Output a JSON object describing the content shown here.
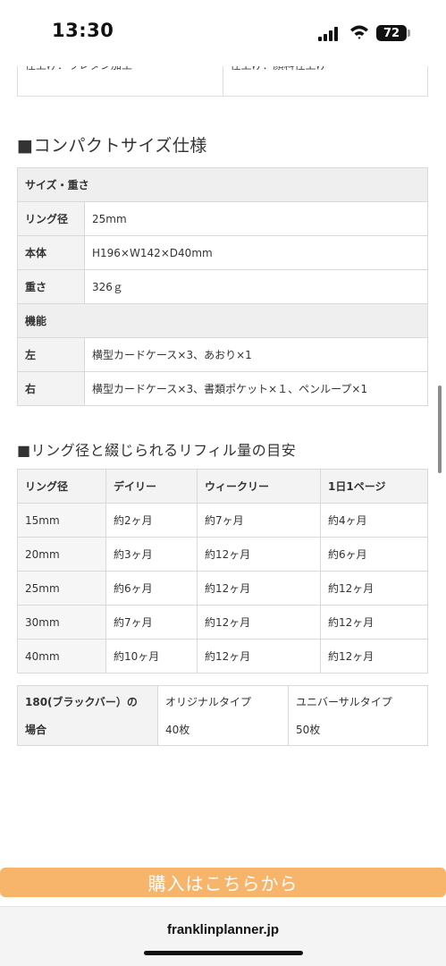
{
  "status_bar": {
    "time": "13:30",
    "battery": "72",
    "icons": [
      "signal-icon",
      "wifi-icon",
      "battery-icon"
    ]
  },
  "top_table": {
    "cells": [
      "仕上げ：ウレタン加工",
      "仕上げ：顔料仕上げ"
    ]
  },
  "compact_section": {
    "title": "■コンパクトサイズ仕様",
    "header": "サイズ・重さ",
    "rows": [
      {
        "label": "リング径",
        "value": "25mm"
      },
      {
        "label": "本体",
        "value": "H196×W142×D40mm"
      },
      {
        "label": "重さ",
        "value": "326ｇ"
      }
    ],
    "function_header": "機能",
    "function_rows": [
      {
        "label": "左",
        "value": "横型カードケース×3、あおり×1"
      },
      {
        "label": "右",
        "value": "横型カードケース×3、書類ポケット×１、ペンループ×1"
      }
    ]
  },
  "ring_section": {
    "title": "■リング径と綴じられるリフィル量の目安",
    "headers": [
      "リング径",
      "デイリー",
      "ウィークリー",
      "1日1ページ"
    ],
    "rows": [
      [
        "15mm",
        "約2ヶ月",
        "約7ヶ月",
        "約4ヶ月"
      ],
      [
        "20mm",
        "約3ヶ月",
        "約12ヶ月",
        "約6ヶ月"
      ],
      [
        "25mm",
        "約6ヶ月",
        "約12ヶ月",
        "約12ヶ月"
      ],
      [
        "30mm",
        "約7ヶ月",
        "約12ヶ月",
        "約12ヶ月"
      ],
      [
        "40mm",
        "約10ヶ月",
        "約12ヶ月",
        "約12ヶ月"
      ]
    ]
  },
  "extra_table": {
    "label_line1": "180(ブラックバー）の",
    "label_line2": "場合",
    "col1_line1": "オリジナルタイプ",
    "col1_line2": "40枚",
    "col2_line1": "ユニバーサルタイプ",
    "col2_line2": "50枚"
  },
  "buy_button": {
    "label": "購入はこちらから"
  },
  "browser": {
    "url": "franklinplanner.jp"
  }
}
